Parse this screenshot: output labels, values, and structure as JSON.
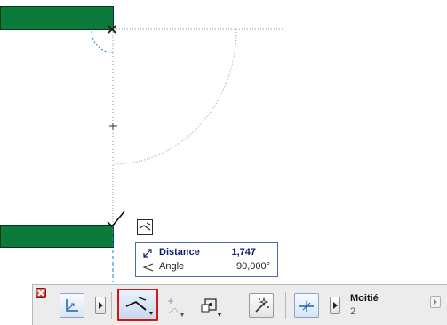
{
  "tracker": {
    "distance_label": "Distance",
    "distance_value": "1,747",
    "angle_label": "Angle",
    "angle_value": "90,000°"
  },
  "toolbar": {
    "division_label": "Moitié",
    "division_value": "2"
  },
  "icons": {
    "close": "close-icon",
    "coordinate": "coordinate-plane-icon",
    "snap_line": "snap-line-icon",
    "polyline": "polyline-icon",
    "snap_points": "snap-points-icon",
    "magic_wand": "magic-wand-icon",
    "division": "division-icon",
    "distance": "distance-icon",
    "angle": "angle-icon"
  },
  "colors": {
    "wall": "#0b7a3b",
    "guide": "#1a7fd0",
    "active_border": "#d01818"
  }
}
